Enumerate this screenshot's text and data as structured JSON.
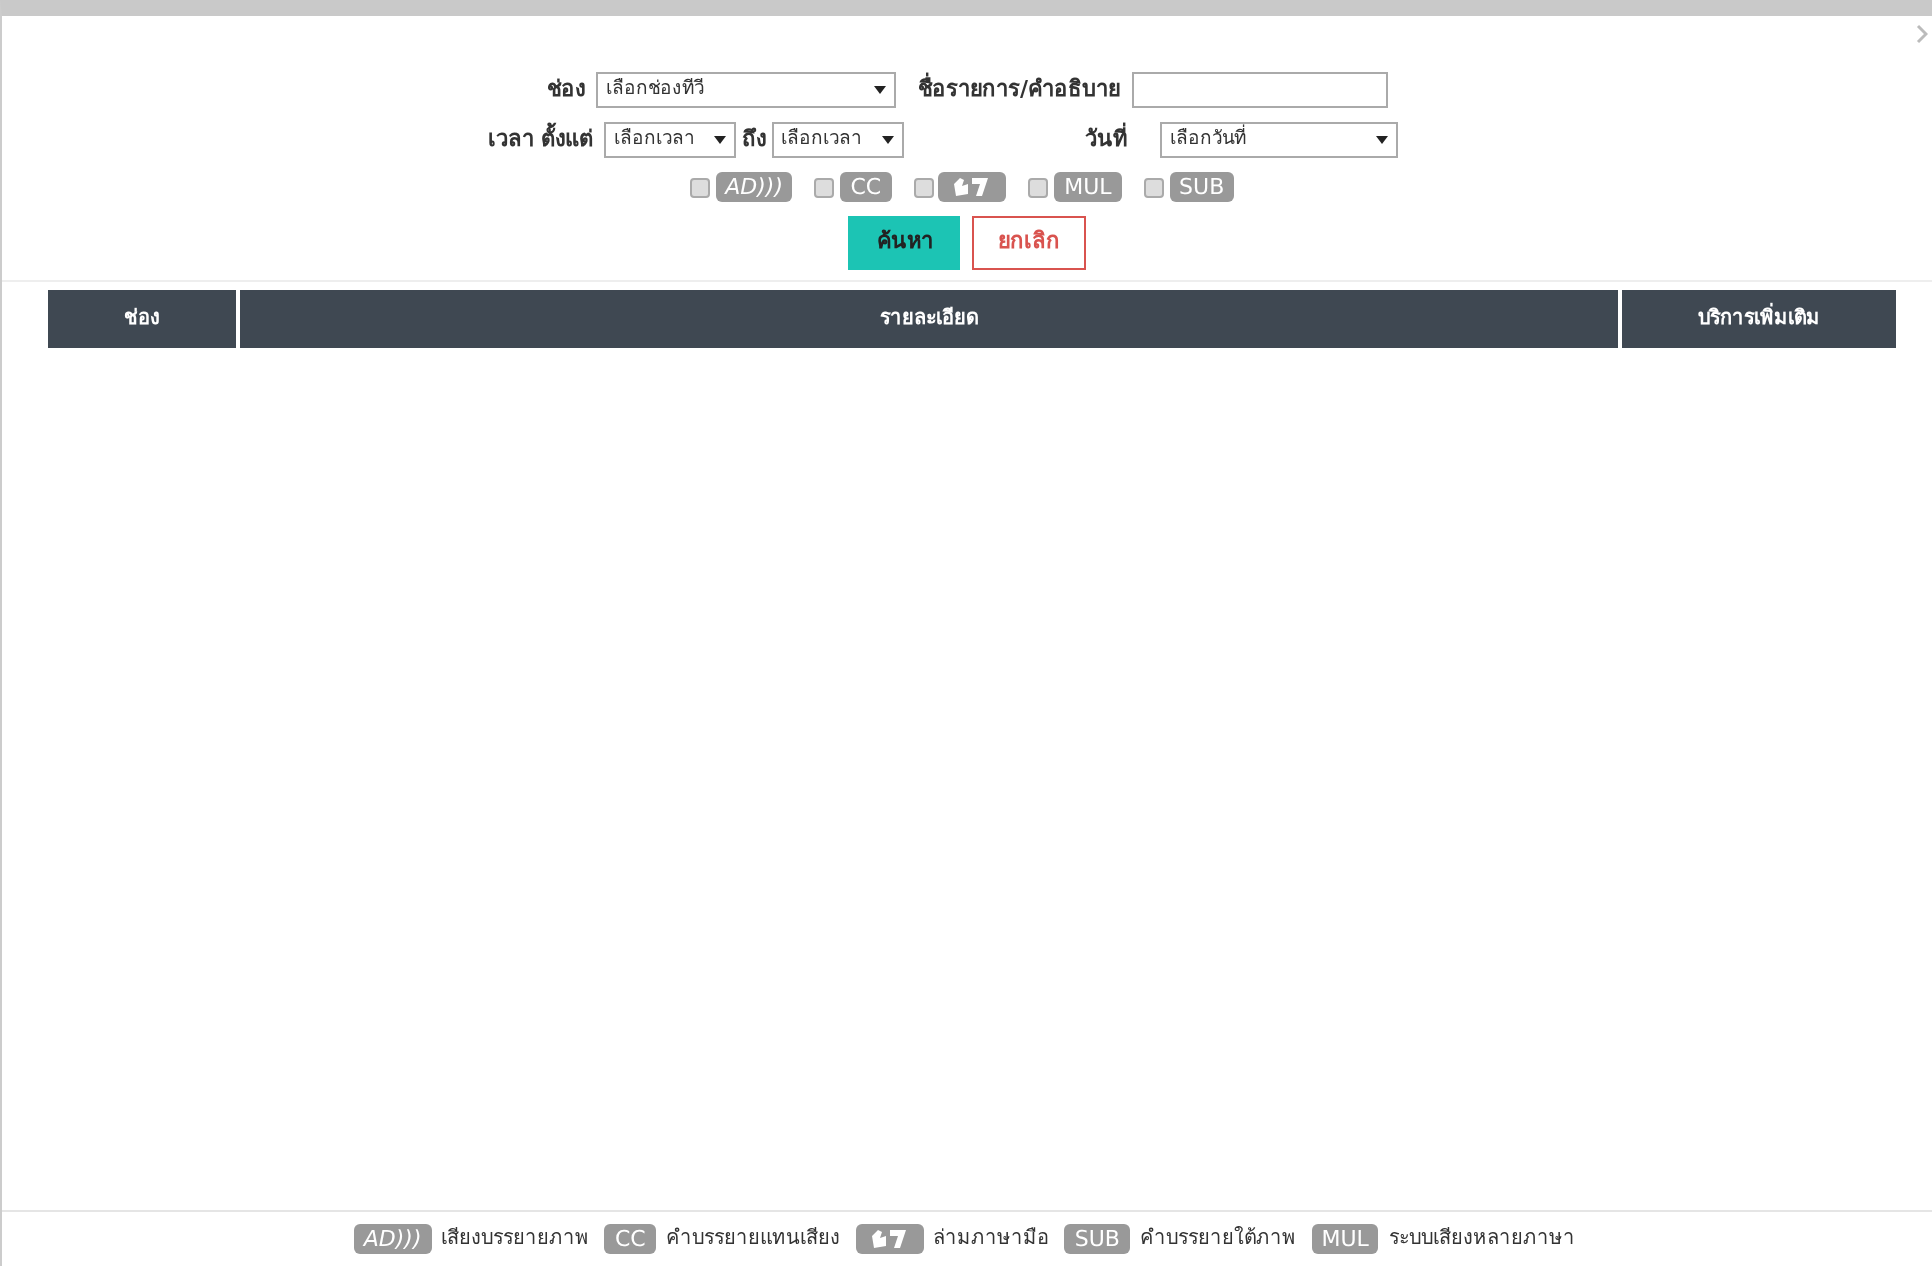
{
  "form": {
    "channel": {
      "label": "ช่อง",
      "value": "เลือกช่องทีวี"
    },
    "title": {
      "label": "ชื่อรายการ/คำอธิบาย"
    },
    "time": {
      "label": "เวลา ตั้งแต่",
      "from": "เลือกเวลา",
      "to_label": "ถึง",
      "to": "เลือกเวลา"
    },
    "date": {
      "label": "วันที่",
      "value": "เลือกวันที่"
    },
    "filters": [
      {
        "kind": "text",
        "text": "AD)))",
        "checked": false
      },
      {
        "kind": "text",
        "text": "CC",
        "checked": false
      },
      {
        "kind": "sign",
        "checked": false
      },
      {
        "kind": "text",
        "text": "MUL",
        "checked": false
      },
      {
        "kind": "text",
        "text": "SUB",
        "checked": false
      }
    ],
    "buttons": [
      {
        "kind": "primary",
        "label": "ค้นหา"
      },
      {
        "kind": "cancel",
        "label": "ยกเลิก"
      }
    ]
  },
  "table": {
    "columns": [
      "ช่อง",
      "รายละเอียด",
      "บริการเพิ่มเติม"
    ]
  },
  "legend": [
    {
      "kind": "text",
      "badge": "AD)))",
      "text": "เสียงบรรยายภาพ"
    },
    {
      "kind": "text",
      "badge": "CC",
      "text": "คำบรรยายแทนเสียง"
    },
    {
      "kind": "sign",
      "text": "ล่ามภาษามือ"
    },
    {
      "kind": "text",
      "badge": "SUB",
      "text": "คำบรรยายใต้ภาพ"
    },
    {
      "kind": "text",
      "badge": "MUL",
      "text": "ระบบเสียงหลายภาษา"
    }
  ]
}
